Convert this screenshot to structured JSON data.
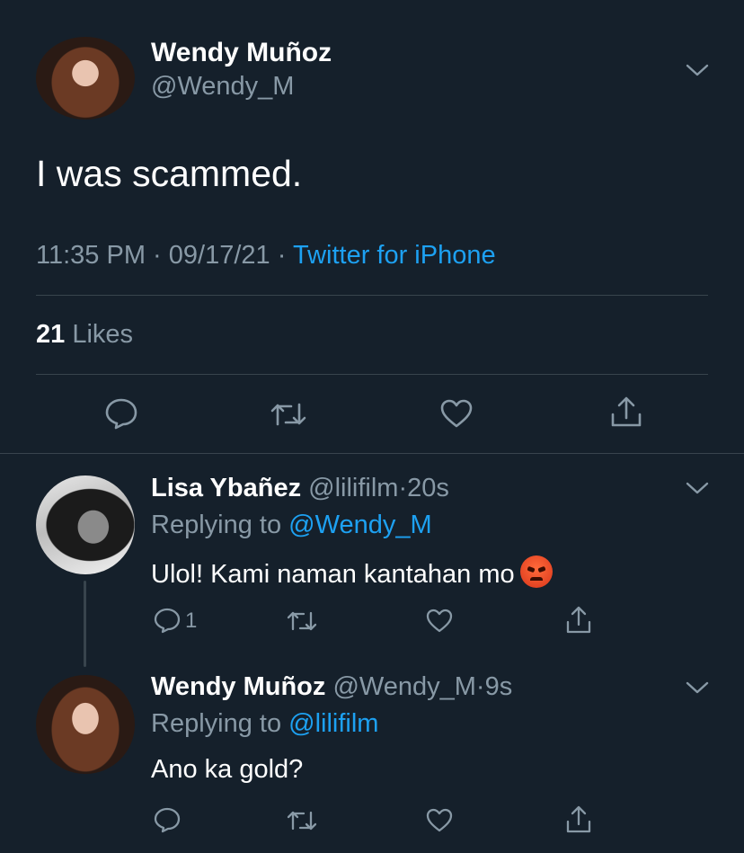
{
  "main_tweet": {
    "author_name": "Wendy Muñoz",
    "handle": "@Wendy_M",
    "text": "I was scammed.",
    "time": "11:35 PM",
    "date": "09/17/21",
    "separator": "·",
    "source": "Twitter for iPhone",
    "likes_count": "21",
    "likes_label": "Likes"
  },
  "replies": [
    {
      "author_name": "Lisa Ybañez",
      "handle": "@lilifilm",
      "age": "20s",
      "replying_prefix": "Replying to",
      "replying_to": "@Wendy_M",
      "text": "Ulol! Kami naman kantahan mo",
      "emoji": "angry-face",
      "reply_count": "1"
    },
    {
      "author_name": "Wendy Muñoz",
      "handle": "@Wendy_M",
      "age": "9s",
      "replying_prefix": "Replying to",
      "replying_to": "@lilifilm",
      "text": "Ano ka gold?"
    }
  ],
  "colors": {
    "background": "#15202b",
    "text": "#ffffff",
    "muted": "#8899a6",
    "link": "#1da1f2",
    "divider": "#38444d"
  },
  "icons": [
    "chevron-down-icon",
    "reply-icon",
    "retweet-icon",
    "like-icon",
    "share-icon"
  ]
}
